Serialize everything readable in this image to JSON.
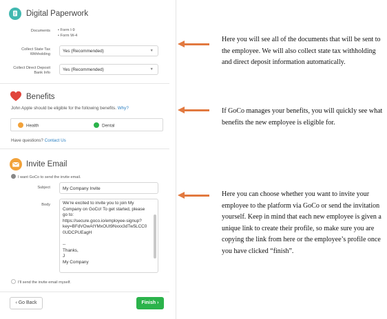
{
  "paperwork": {
    "title": "Digital Paperwork",
    "documents_label": "Documents",
    "documents": [
      "Form I-9",
      "Form W-4"
    ],
    "state_tax_label_1": "Collect State Tax",
    "state_tax_label_2": "Withholding",
    "state_tax_value": "Yes (Recommended)",
    "direct_deposit_label_1": "Collect Direct Deposit",
    "direct_deposit_label_2": "Bank Info",
    "direct_deposit_value": "Yes (Recommended)"
  },
  "benefits": {
    "title": "Benefits",
    "eligible_text": "John Apple should be eligible for the following benefits.",
    "why_link": "Why?",
    "items": [
      "Health",
      "Dental"
    ],
    "questions_text": "Have questions?",
    "contact_link": "Contact Us"
  },
  "invite": {
    "title": "Invite Email",
    "option_goco": "I want GoCo to send the invite email.",
    "subject_label": "Subject",
    "subject_value": "My Company Invite",
    "body_label": "Body",
    "body_text": "We're excited to invite you to join My\nCompany on GoCo! To get started, please\ngo to:\nhttps://secure.goco.io/employee-signup?\nkey=BFdVOwAtYMxOUt9Nxxx3dTw5LCC0\n0UDCPUEagH\n\n--\nThanks,\nJ\nMy Company",
    "option_self": "I'll send the invite email myself."
  },
  "footer": {
    "back_label": "‹ Go Back",
    "finish_label": "Finish ›"
  },
  "notes": {
    "paperwork": "Here you will see all of the documents that will be sent to the employee. We will also collect state tax withholding and direct deposit information automatically.",
    "benefits": "If GoCo manages your benefits, you will quickly see what benefits the new employee is eligible for.",
    "invite": "Here you can choose whether you want to invite your employee to the platform via GoCo or send the invitation yourself. Keep in mind that each new employee is given a unique link to create their profile, so make sure you are copying the link from here or the employee’s profile once you have clicked “finish”."
  },
  "colors": {
    "accent_green": "#2bb34b",
    "arrow_orange": "#e2793f",
    "heart_red": "#e0453c",
    "paperwork_teal": "#41b8b0",
    "invite_orange": "#f2a23a",
    "link_blue": "#2a7fc1"
  }
}
